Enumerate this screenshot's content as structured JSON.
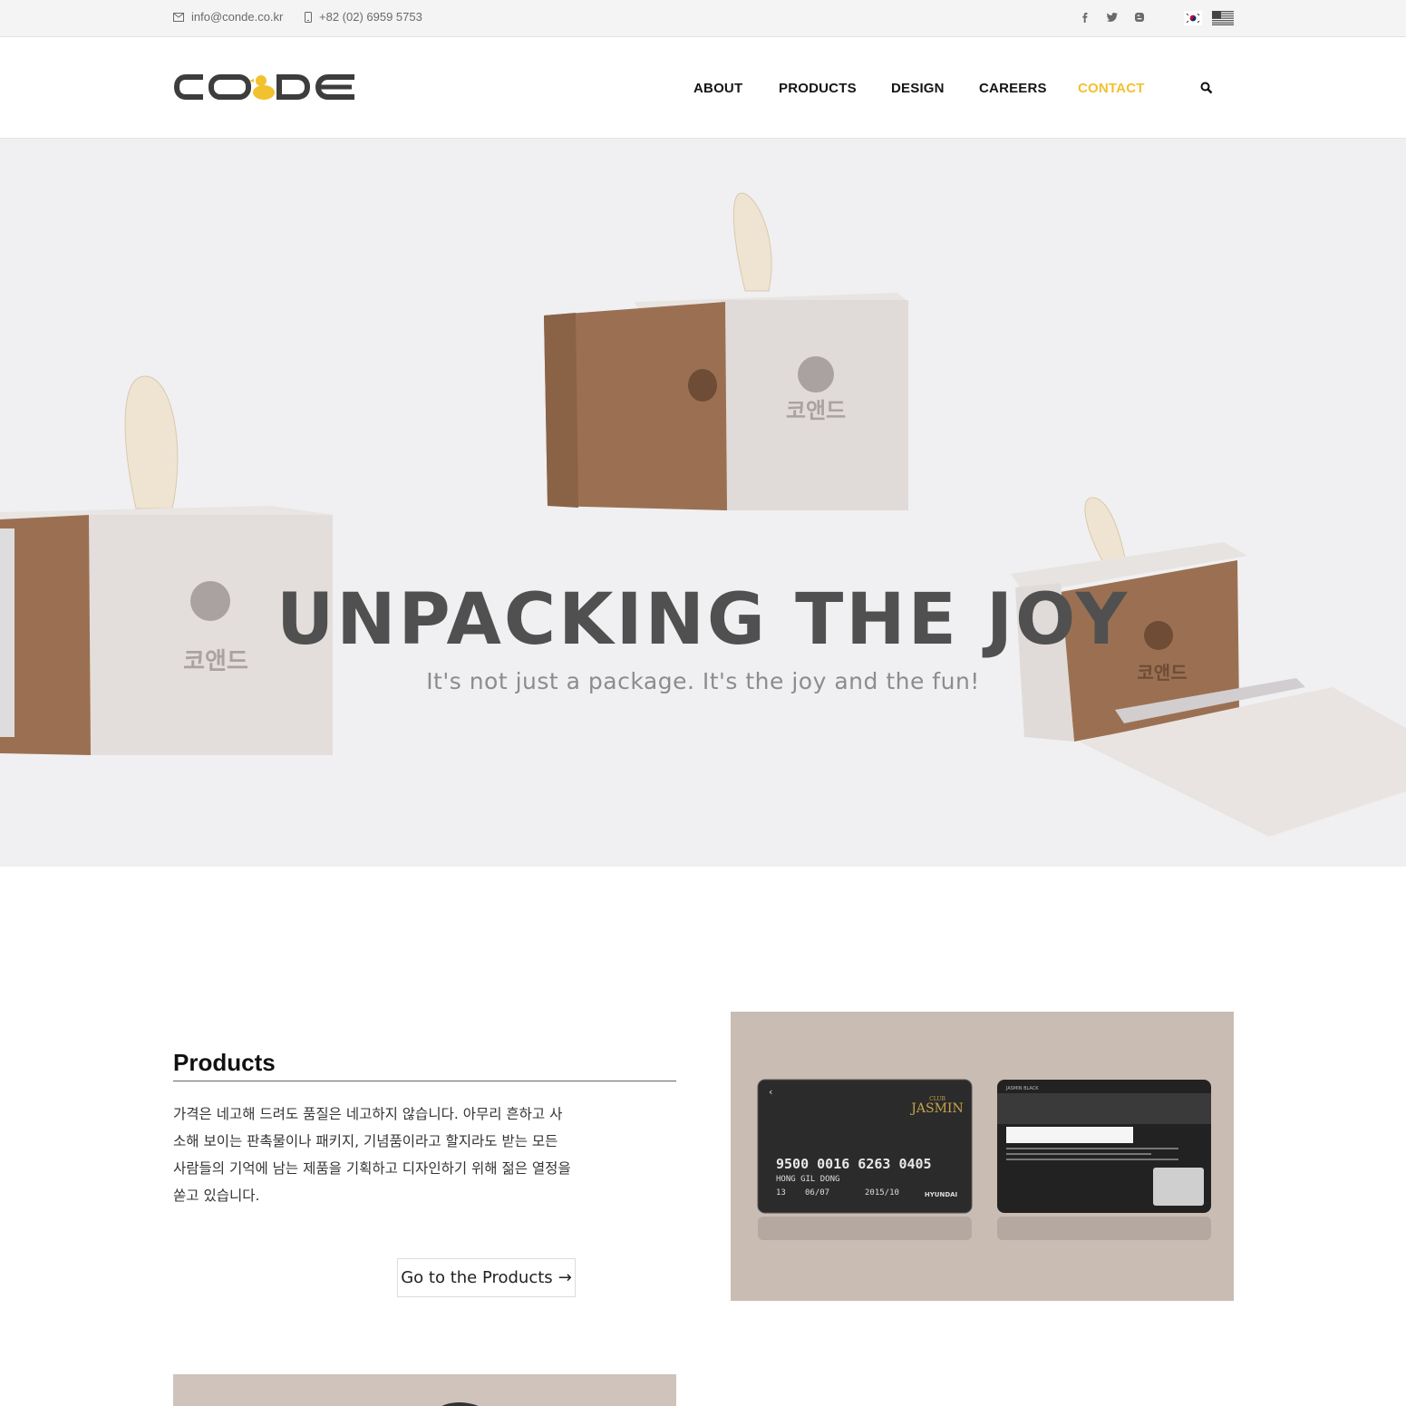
{
  "topbar": {
    "email": "info@conde.co.kr",
    "phone": "+82 (02) 6959 5753",
    "social": [
      "facebook-icon",
      "twitter-icon",
      "blogger-icon"
    ],
    "languages": [
      "korean-flag",
      "us-flag"
    ]
  },
  "header": {
    "logo_text": "CO&DE",
    "nav": [
      "ABOUT",
      "PRODUCTS",
      "DESIGN",
      "CAREERS",
      "CONTACT"
    ],
    "active_nav": "CONTACT",
    "accent_color": "#f2c12e"
  },
  "hero": {
    "title": "UNPACKING THE JOY",
    "subtitle": "It's not just a package. It's the joy and the fun!",
    "box_label": "코앤드"
  },
  "products_section": {
    "title": "Products",
    "body": "가격은 네고해 드려도 품질은 네고하지 않습니다. 아무리 흔하고 사소해 보이는 판촉물이나 패키지, 기념품이라고 할지라도 받는 모든 사람들의 기억에 남는 제품을 기획하고 디자인하기 위해 젊은 열정을 쏟고 있습니다.",
    "cta_label": "Go to the Products",
    "cta_arrow": "→"
  },
  "card_front": {
    "brand": "JASMIN",
    "brand_top": "CLUB",
    "number": "9500 0016 6263 0405",
    "name": "HONG GIL DONG",
    "left_code": "13",
    "member_since": "06/07",
    "valid_thru": "2015/10",
    "issuer": "HYUNDAI"
  },
  "card_back": {
    "label": "JASMIN BLACK"
  }
}
